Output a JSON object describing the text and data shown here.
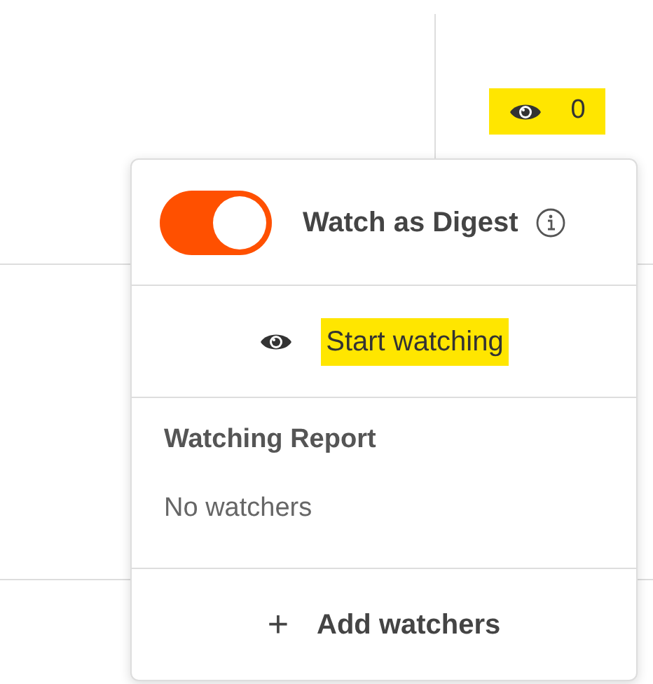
{
  "watch_badge": {
    "count": "0",
    "highlighted": true
  },
  "popup": {
    "digest": {
      "label": "Watch as Digest",
      "on": true
    },
    "start_watching": {
      "label": "Start watching",
      "highlighted": true
    },
    "report": {
      "title": "Watching Report",
      "empty_text": "No watchers"
    },
    "add_watchers": {
      "icon": "+",
      "label": "Add watchers"
    }
  }
}
